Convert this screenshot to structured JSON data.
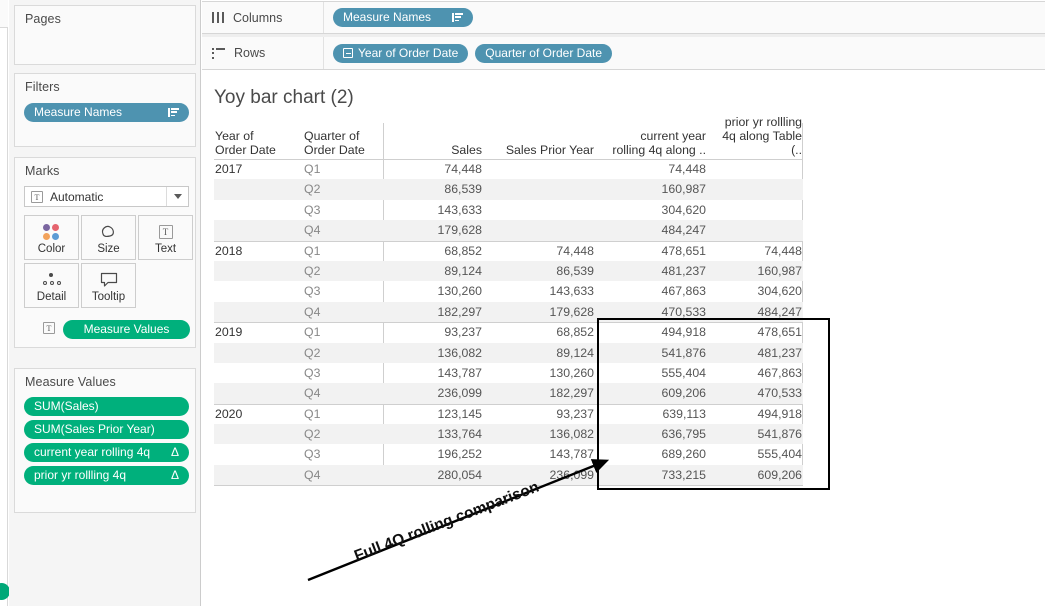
{
  "left_rail": {
    "green_dot_color": "#00a878"
  },
  "cards": {
    "pages": {
      "title": "Pages"
    },
    "filters": {
      "title": "Filters",
      "pills": [
        {
          "label": "Measure Names",
          "icon": "sort-icon",
          "color": "#4e93b0"
        }
      ]
    },
    "marks": {
      "title": "Marks",
      "mark_type": "Automatic",
      "mark_type_icon": "text-mark-icon",
      "dropdown_icon": "chevron-down-icon",
      "buttons": [
        {
          "label": "Color",
          "icon": "color-dots-icon"
        },
        {
          "label": "Size",
          "icon": "size-shape-icon"
        },
        {
          "label": "Text",
          "icon": "text-glyph-icon"
        },
        {
          "label": "Detail",
          "icon": "detail-dots-icon"
        },
        {
          "label": "Tooltip",
          "icon": "tooltip-bubble-icon"
        }
      ],
      "encoding_pill": {
        "label": "Measure Values",
        "glyph": "T",
        "color": "#00b07c"
      }
    },
    "measure_values": {
      "title": "Measure Values",
      "pills": [
        {
          "label": "SUM(Sales)",
          "delta": "",
          "color": "#00b07c"
        },
        {
          "label": "SUM(Sales Prior Year)",
          "delta": "",
          "color": "#00b07c"
        },
        {
          "label": "current year rolling 4q",
          "delta": "Δ",
          "color": "#00b07c"
        },
        {
          "label": "prior yr rollling 4q",
          "delta": "Δ",
          "color": "#00b07c"
        }
      ]
    }
  },
  "shelves": {
    "columns": {
      "label": "Columns",
      "icon": "columns-icon",
      "pills": [
        {
          "label": "Measure Names",
          "icon": "sort-icon"
        }
      ]
    },
    "rows": {
      "label": "Rows",
      "icon": "rows-icon",
      "pills": [
        {
          "label": "Year of Order Date",
          "icon": "minus-box-icon"
        },
        {
          "label": "Quarter of Order Date",
          "icon": ""
        }
      ]
    }
  },
  "worksheet": {
    "title": "Yoy bar chart (2)",
    "annotation": "Full 4Q rolling comparison",
    "highlight_box": {
      "color": "#000000",
      "covers_columns": [
        "current year rolling 4q along ..",
        "prior yr rollling 4q along Table (.."
      ],
      "covers_years": [
        "2019",
        "2020"
      ]
    }
  },
  "chart_data": {
    "type": "table",
    "title": "Yoy bar chart (2)",
    "columns": [
      "Year of Order Date",
      "Quarter of Order Date",
      "Sales",
      "Sales Prior Year",
      "current year rolling 4q along ..",
      "prior yr rollling 4q along Table (.."
    ],
    "column_headers_wrapped": [
      [
        "Year of",
        "Order Date"
      ],
      [
        "Quarter of",
        "Order Date"
      ],
      [
        "",
        "Sales"
      ],
      [
        "",
        "Sales Prior Year"
      ],
      [
        "current year",
        "rolling 4q along .."
      ],
      [
        "prior yr rollling",
        "4q along Table (.."
      ]
    ],
    "rows": [
      {
        "year": "2017",
        "quarter": "Q1",
        "sales": "74,448",
        "sales_prior_year": "",
        "current_year_rolling_4q": "74,448",
        "prior_yr_rolling_4q": ""
      },
      {
        "year": "",
        "quarter": "Q2",
        "sales": "86,539",
        "sales_prior_year": "",
        "current_year_rolling_4q": "160,987",
        "prior_yr_rolling_4q": ""
      },
      {
        "year": "",
        "quarter": "Q3",
        "sales": "143,633",
        "sales_prior_year": "",
        "current_year_rolling_4q": "304,620",
        "prior_yr_rolling_4q": ""
      },
      {
        "year": "",
        "quarter": "Q4",
        "sales": "179,628",
        "sales_prior_year": "",
        "current_year_rolling_4q": "484,247",
        "prior_yr_rolling_4q": ""
      },
      {
        "year": "2018",
        "quarter": "Q1",
        "sales": "68,852",
        "sales_prior_year": "74,448",
        "current_year_rolling_4q": "478,651",
        "prior_yr_rolling_4q": "74,448"
      },
      {
        "year": "",
        "quarter": "Q2",
        "sales": "89,124",
        "sales_prior_year": "86,539",
        "current_year_rolling_4q": "481,237",
        "prior_yr_rolling_4q": "160,987"
      },
      {
        "year": "",
        "quarter": "Q3",
        "sales": "130,260",
        "sales_prior_year": "143,633",
        "current_year_rolling_4q": "467,863",
        "prior_yr_rolling_4q": "304,620"
      },
      {
        "year": "",
        "quarter": "Q4",
        "sales": "182,297",
        "sales_prior_year": "179,628",
        "current_year_rolling_4q": "470,533",
        "prior_yr_rolling_4q": "484,247"
      },
      {
        "year": "2019",
        "quarter": "Q1",
        "sales": "93,237",
        "sales_prior_year": "68,852",
        "current_year_rolling_4q": "494,918",
        "prior_yr_rolling_4q": "478,651"
      },
      {
        "year": "",
        "quarter": "Q2",
        "sales": "136,082",
        "sales_prior_year": "89,124",
        "current_year_rolling_4q": "541,876",
        "prior_yr_rolling_4q": "481,237"
      },
      {
        "year": "",
        "quarter": "Q3",
        "sales": "143,787",
        "sales_prior_year": "130,260",
        "current_year_rolling_4q": "555,404",
        "prior_yr_rolling_4q": "467,863"
      },
      {
        "year": "",
        "quarter": "Q4",
        "sales": "236,099",
        "sales_prior_year": "182,297",
        "current_year_rolling_4q": "609,206",
        "prior_yr_rolling_4q": "470,533"
      },
      {
        "year": "2020",
        "quarter": "Q1",
        "sales": "123,145",
        "sales_prior_year": "93,237",
        "current_year_rolling_4q": "639,113",
        "prior_yr_rolling_4q": "494,918"
      },
      {
        "year": "",
        "quarter": "Q2",
        "sales": "133,764",
        "sales_prior_year": "136,082",
        "current_year_rolling_4q": "636,795",
        "prior_yr_rolling_4q": "541,876"
      },
      {
        "year": "",
        "quarter": "Q3",
        "sales": "196,252",
        "sales_prior_year": "143,787",
        "current_year_rolling_4q": "689,260",
        "prior_yr_rolling_4q": "555,404"
      },
      {
        "year": "",
        "quarter": "Q4",
        "sales": "280,054",
        "sales_prior_year": "236,099",
        "current_year_rolling_4q": "733,215",
        "prior_yr_rolling_4q": "609,206"
      }
    ]
  }
}
